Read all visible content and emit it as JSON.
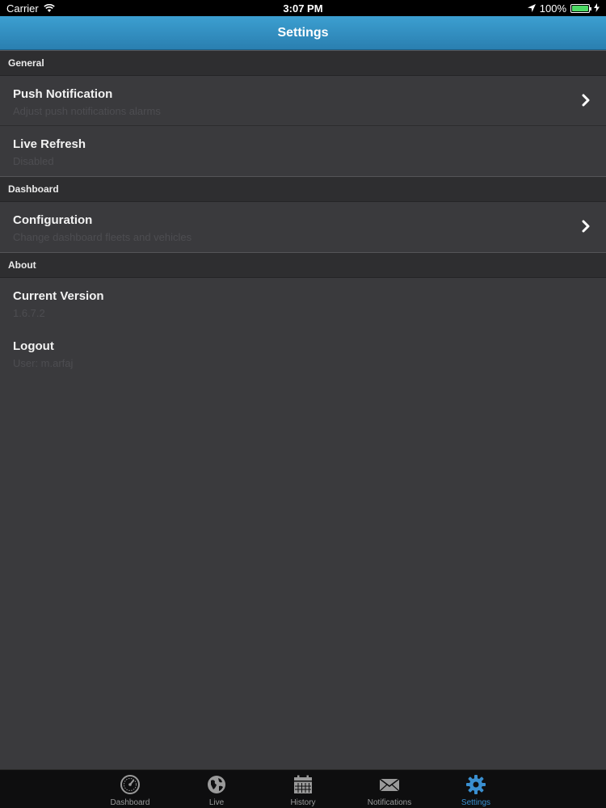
{
  "status_bar": {
    "carrier": "Carrier",
    "time": "3:07 PM",
    "battery": "100%"
  },
  "nav": {
    "title": "Settings"
  },
  "sections": {
    "general": {
      "header": "General",
      "push": {
        "title": "Push Notification",
        "subtitle": "Adjust push notifications alarms"
      },
      "live_refresh": {
        "title": "Live Refresh",
        "subtitle": "Disabled"
      }
    },
    "dashboard": {
      "header": "Dashboard",
      "configuration": {
        "title": "Configuration",
        "subtitle": "Change dashboard fleets and vehicles"
      }
    },
    "about": {
      "header": "About",
      "version": {
        "title": "Current Version",
        "subtitle": "1.6.7.2"
      },
      "logout": {
        "title": "Logout",
        "subtitle": "User: m.arfaj"
      }
    }
  },
  "tabs": {
    "dashboard": "Dashboard",
    "live": "Live",
    "history": "History",
    "notifications": "Notifications",
    "settings": "Settings"
  },
  "colors": {
    "nav_bar": "#3c9fd1",
    "background": "#3a3a3d",
    "active_tab": "#3a8fd0",
    "battery": "#4cd964"
  }
}
